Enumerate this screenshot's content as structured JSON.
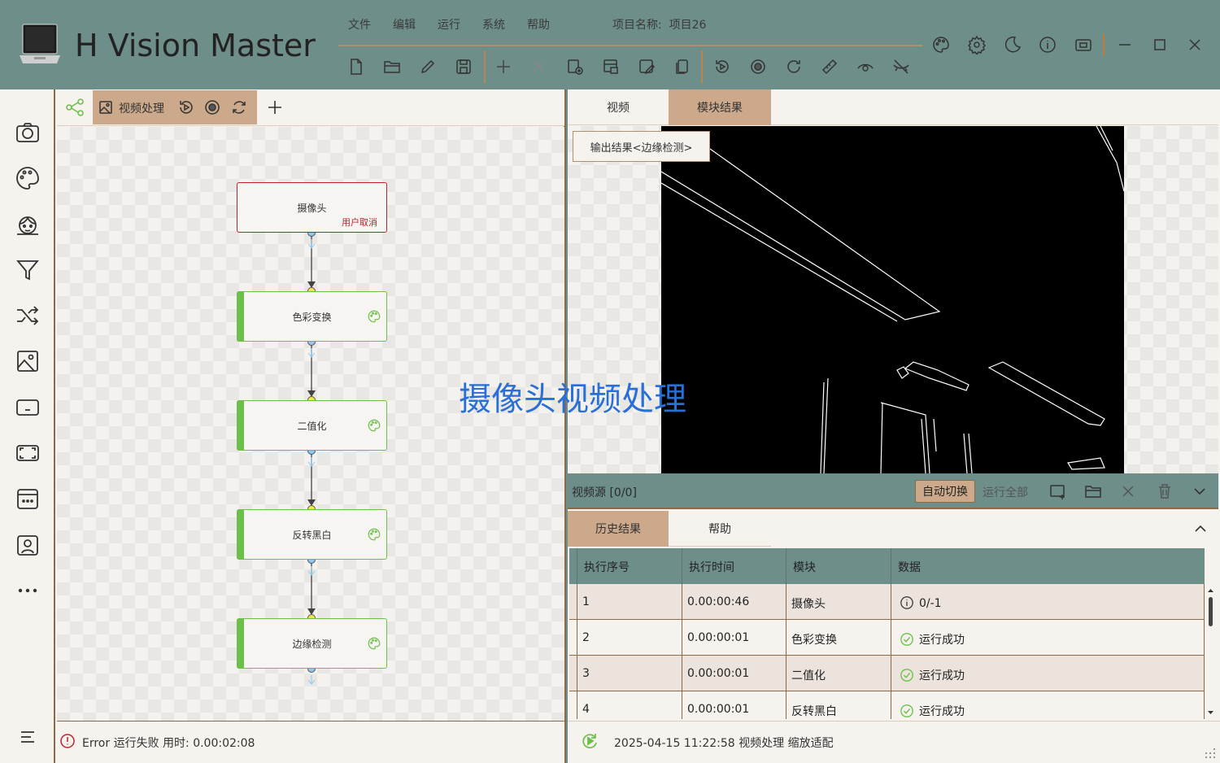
{
  "app": {
    "title": "H Vision Master"
  },
  "menu": {
    "file": "文件",
    "edit": "编辑",
    "run": "运行",
    "system": "系统",
    "help": "帮助"
  },
  "project": {
    "label": "项目名称:",
    "name": "项目26"
  },
  "process_tab": {
    "label": "视频处理"
  },
  "nodes": [
    {
      "label": "摄像头",
      "status": "用户取消"
    },
    {
      "label": "色彩变换"
    },
    {
      "label": "二值化"
    },
    {
      "label": "反转黑白"
    },
    {
      "label": "边缘检测"
    }
  ],
  "canvas_status": {
    "text": "Error 运行失败 用时: 0.00:02:08"
  },
  "right_tabs": {
    "video": "视频",
    "module_result": "模块结果"
  },
  "output_button": {
    "label": "输出结果<边缘检测>"
  },
  "overlay": {
    "text": "摄像头视频处理"
  },
  "video_source": {
    "label": "视频源 [0/0]",
    "auto_switch": "自动切换",
    "run_all": "运行全部"
  },
  "history_tabs": {
    "history": "历史结果",
    "help": "帮助"
  },
  "table": {
    "headers": [
      "执行序号",
      "执行时间",
      "模块",
      "数据"
    ],
    "rows": [
      {
        "index": "1",
        "time": "0.00:00:46",
        "module": "摄像头",
        "data": "0/-1",
        "status": "info"
      },
      {
        "index": "2",
        "time": "0.00:00:01",
        "module": "色彩变换",
        "data": "运行成功",
        "status": "success"
      },
      {
        "index": "3",
        "time": "0.00:00:01",
        "module": "二值化",
        "data": "运行成功",
        "status": "success"
      },
      {
        "index": "4",
        "time": "0.00:00:01",
        "module": "反转黑白",
        "data": "运行成功",
        "status": "success"
      }
    ]
  },
  "status_bar_right": {
    "text": "2025-04-15 11:22:58  视频处理 缩放适配"
  },
  "colors": {
    "theme": "#6e8e8a",
    "accent": "#cba98a",
    "success": "#6cc04a",
    "error": "#c0202a",
    "overlay": "#2a6fd6"
  }
}
